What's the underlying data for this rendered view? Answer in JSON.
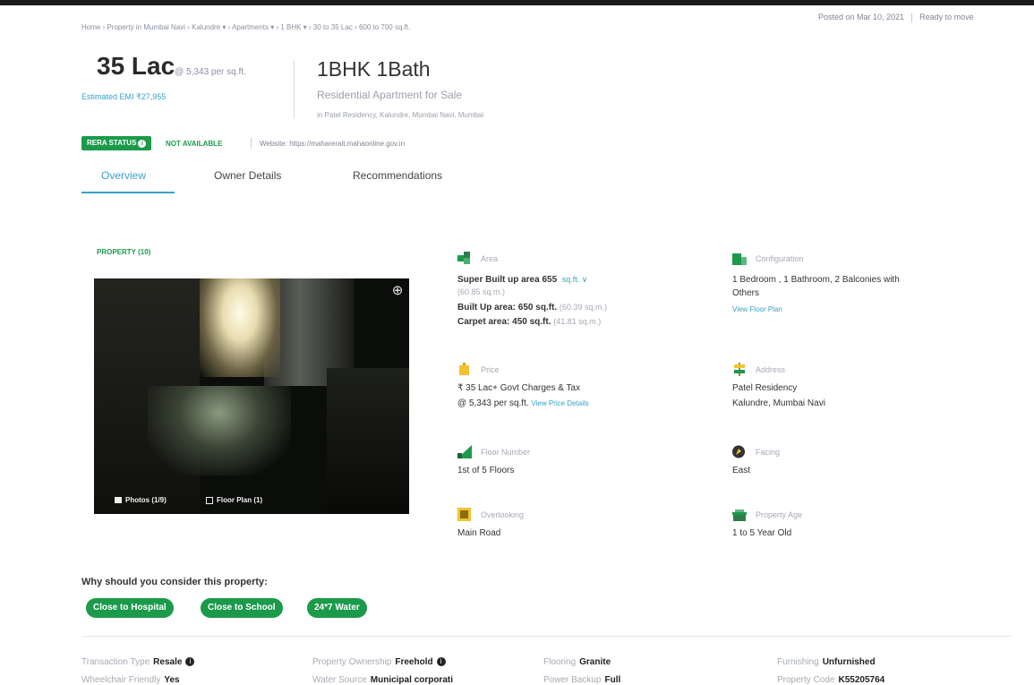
{
  "breadcrumb": "Home › Property in Mumbai Navi › Kalundre ▾ › Apartments ▾ › 1 BHK ▾ › 30 to 35 Lac › 600 to 700 sq.ft.",
  "header": {
    "posted": "Posted on Mar 10, 2021",
    "status": "Ready to move",
    "price": "35 Lac",
    "price_per": "@ 5,343 per sq.ft.",
    "emi": "Estimated EMI ₹27,955",
    "title": "1BHK 1Bath",
    "subtitle": "Residential Apartment for Sale",
    "locality": "in Patel Residency, Kalundre, Mumbai Navi, Mumbai"
  },
  "rera": {
    "badge": "RERA STATUS",
    "status": "NOT AVAILABLE",
    "website": "Website: https://maharerait.mahaonline.gov.in"
  },
  "tabs": [
    {
      "label": "Overview"
    },
    {
      "label": "Owner Details"
    },
    {
      "label": "Recommendations"
    }
  ],
  "gallery": {
    "title": "PROPERTY (10)",
    "photos": "Photos (1/9)",
    "floor_plan": "Floor Plan (1)"
  },
  "details": {
    "area": {
      "label": "Area",
      "super": "Super Built up area 655",
      "unit": "sq.ft. ∨",
      "super_sqm": "(60.85 sq.m.)",
      "built": "Built Up area: 650 sq.ft.",
      "built_sqm": "(60.39 sq.m.)",
      "carpet": "Carpet area: 450 sq.ft.",
      "carpet_sqm": "(41.81 sq.m.)"
    },
    "configuration": {
      "label": "Configuration",
      "line1": "1 Bedroom , 1 Bathroom, 2 Balconies with",
      "line2": "Others",
      "link": "View Floor Plan"
    },
    "price": {
      "label": "Price",
      "line1": "₹ 35 Lac+ Govt Charges & Tax",
      "line2": "@ 5,343 per sq.ft.",
      "link": "View Price Details"
    },
    "address": {
      "label": "Address",
      "line1": "Patel Residency",
      "line2": "Kalundre, Mumbai Navi"
    },
    "floor": {
      "label": "Floor Number",
      "value": "1st  of 5 Floors"
    },
    "facing": {
      "label": "Facing",
      "value": "East"
    },
    "overlooking": {
      "label": "Overlooking",
      "value": "Main Road"
    },
    "age": {
      "label": "Property Age",
      "value": "1 to 5 Year Old"
    }
  },
  "why": {
    "title": "Why should you consider this property:",
    "pills": [
      "Close to Hospital",
      "Close to School",
      "24*7 Water"
    ]
  },
  "specs": {
    "row1": [
      {
        "k": "Transaction Type",
        "v": "Resale"
      },
      {
        "k": "Property Ownership",
        "v": "Freehold"
      },
      {
        "k": "Flooring",
        "v": "Granite"
      },
      {
        "k": "Furnishing",
        "v": "Unfurnished"
      }
    ],
    "row2": [
      {
        "k": "Wheelchair Friendly",
        "v": "Yes"
      },
      {
        "k": "Water Source",
        "v": "Municipal corporati"
      },
      {
        "k": "Power Backup",
        "v": "Full"
      },
      {
        "k": "Property Code",
        "v": "K55205764"
      }
    ]
  },
  "colors": {
    "accent": "#38a1c6",
    "green": "#1c9a4b"
  }
}
